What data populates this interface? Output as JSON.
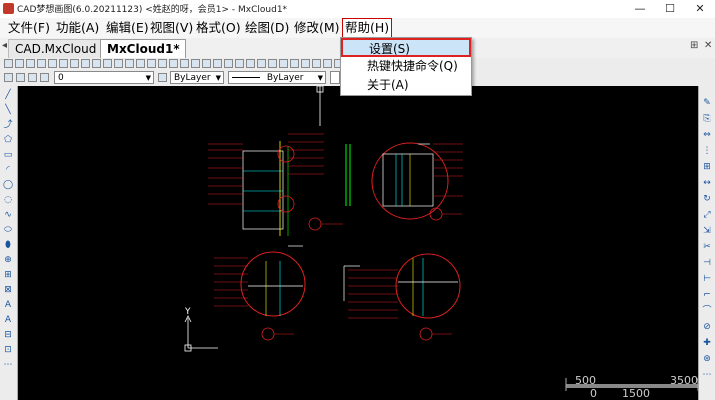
{
  "window": {
    "title": "CAD梦想画图(6.0.20211123) <姓赵的呀，会员1> - MxCloud1*",
    "minimize": "—",
    "maximize": "☐",
    "close": "✕"
  },
  "menu": {
    "file": "文件(F)",
    "function": "功能(A)",
    "edit": "编辑(E)",
    "view": "视图(V)",
    "format": "格式(O)",
    "draw": "绘图(D)",
    "modify": "修改(M)",
    "help": "帮助(H)"
  },
  "help_menu": {
    "settings": "设置(S)",
    "shortcuts": "热键快捷命令(Q)",
    "about": "关于(A)"
  },
  "tabs": {
    "tab1": "CAD.MxCloud",
    "tab2": "MxCloud1*",
    "close_icon": "✕",
    "pin_icon": "⊞"
  },
  "toolbar": {
    "layer_value": "0",
    "color_value": "ByLayer",
    "linetype_value": "ByLayer"
  },
  "canvas": {
    "scale_left": "500",
    "scale_right": "3500",
    "scale_bottom_mid": "0",
    "scale_bottom_right": "1500",
    "axis_y": "Y"
  },
  "colors": {
    "canvas_bg": "#000000",
    "highlight_border": "#d22222",
    "drawing_red": "#e02020",
    "drawing_yellow": "#e0c020"
  }
}
